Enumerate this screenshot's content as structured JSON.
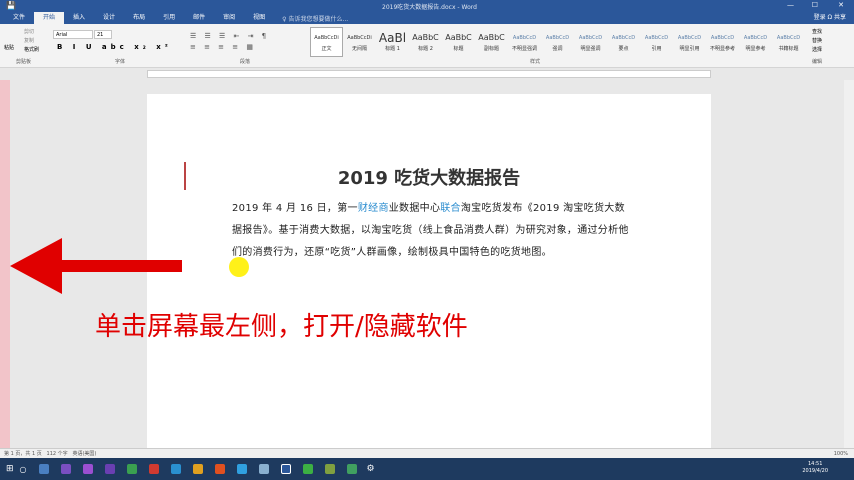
{
  "window": {
    "title": "2019吃货大数据报告.docx - Word",
    "quick_access": "💾"
  },
  "tabs": [
    "文件",
    "开始",
    "插入",
    "设计",
    "布局",
    "引用",
    "邮件",
    "审阅",
    "视图"
  ],
  "active_tab": "开始",
  "tell_me": "♀ 告诉我您想要做什么...",
  "share": "登录  Ω 共享",
  "ribbon": {
    "font": "Arial",
    "size": "21",
    "groups": [
      "剪贴板",
      "字体",
      "段落",
      "样式",
      "编辑"
    ],
    "clipboard": [
      "剪切",
      "复制",
      "格式刷"
    ],
    "paste": "粘贴",
    "edit": [
      "查找",
      "替换",
      "选择"
    ],
    "styles": [
      {
        "sample": "AaBbCcDi",
        "name": "正文"
      },
      {
        "sample": "AaBbCcDi",
        "name": "无间隔"
      },
      {
        "sample": "AaBl",
        "name": "标题 1"
      },
      {
        "sample": "AaBbC",
        "name": "标题 2"
      },
      {
        "sample": "AaBbC",
        "name": "标题"
      },
      {
        "sample": "AaBbC",
        "name": "副标题"
      },
      {
        "sample": "AaBbCcD",
        "name": "不明显强调"
      },
      {
        "sample": "AaBbCcD",
        "name": "强调"
      },
      {
        "sample": "AaBbCcD",
        "name": "明显强调"
      },
      {
        "sample": "AaBbCcD",
        "name": "要点"
      },
      {
        "sample": "AaBbCcD",
        "name": "引用"
      },
      {
        "sample": "AaBbCcD",
        "name": "明显引用"
      },
      {
        "sample": "AaBbCcD",
        "name": "不明显参考"
      },
      {
        "sample": "AaBbCcD",
        "name": "明显参考"
      },
      {
        "sample": "AaBbCcD",
        "name": "书籍标题"
      }
    ]
  },
  "document": {
    "title": "2019 吃货大数据报告",
    "para_a": "2019 年 4 月 16 日，第一",
    "link1": "财经商",
    "para_b": "业数据中心",
    "link2": "联合",
    "para_c": "淘宝吃货发布《2019 淘宝吃货大数据报告》。基于消费大数据，以淘宝吃货（线上食品消费人群）为研究对象，通过分析他们的消费行为，还原“吃货”人群画像，绘制极具中国特色的吃货地图。"
  },
  "overlay_hint": "单击屏幕最左侧，打开/隐藏软件",
  "status": {
    "page": "第 1 页，共 1 页",
    "words": "112 个字",
    "lang": "英语(美国)",
    "zoom": "100%"
  },
  "clock": {
    "time": "14:51",
    "date": "2019/4/20"
  }
}
